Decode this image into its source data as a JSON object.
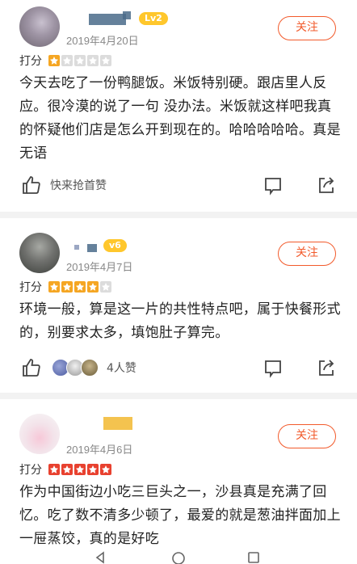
{
  "reviews": [
    {
      "level_badge": "Lv2",
      "date": "2019年4月20日",
      "follow_label": "关注",
      "rating_label": "打分",
      "stars": 1,
      "content": "今天去吃了一份鸭腿饭。米饭特别硬。跟店里人反应。很冷漠的说了一句 没办法。米饭就这样吧我真的怀疑他们店是怎么开到现在的。哈哈哈哈哈。真是无语",
      "like_text": "快来抢首赞"
    },
    {
      "level_badge": "v6",
      "date": "2019年4月7日",
      "follow_label": "关注",
      "rating_label": "打分",
      "stars": 4,
      "content": "环境一般，算是这一片的共性特点吧，属于快餐形式的，别要求太多，填饱肚子算完。",
      "like_text": "4人赞"
    },
    {
      "level_badge": "",
      "date": "2019年4月6日",
      "follow_label": "关注",
      "rating_label": "打分",
      "stars": 5,
      "content": "作为中国街边小吃三巨头之一，沙县真是充满了回忆。吃了数不清多少顿了，最爱的就是葱油拌面加上一屉蒸饺，真的是好吃"
    }
  ],
  "colors": {
    "accent": "#f25a2b",
    "star_orange": "#f5a623",
    "star_red": "#e8412f",
    "badge_yellow": "#ffc72c"
  }
}
